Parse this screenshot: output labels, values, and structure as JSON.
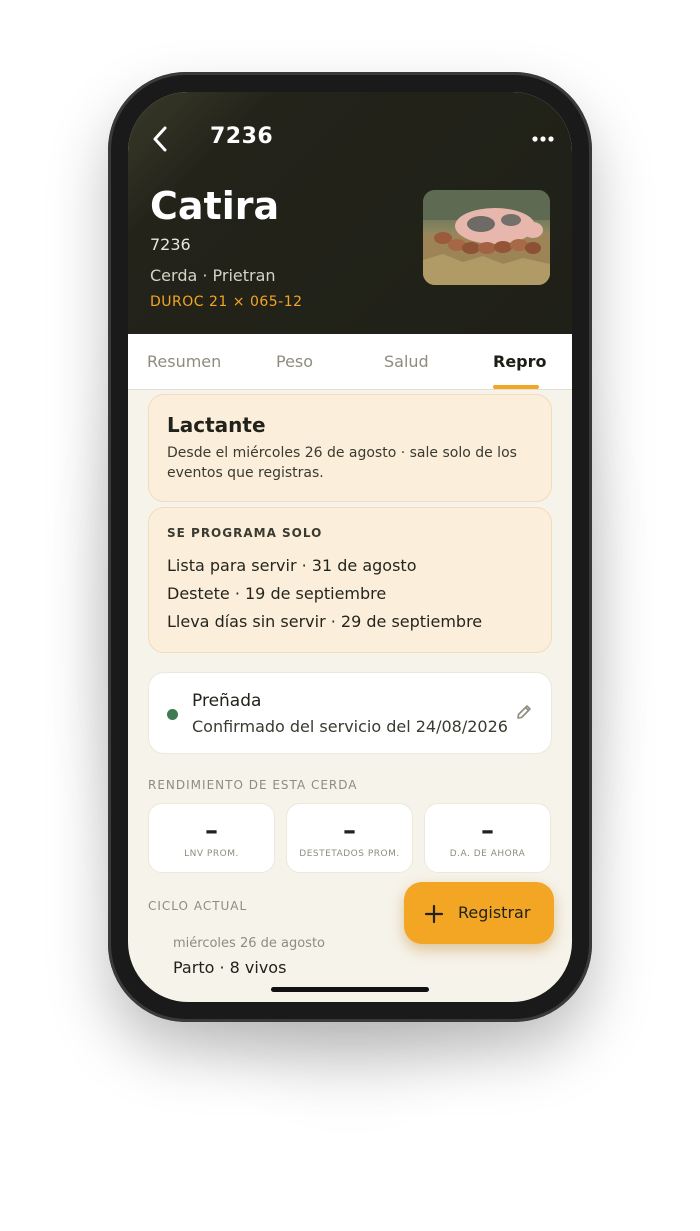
{
  "nav": {
    "title": "7236",
    "back_icon": "chevron-left-icon",
    "more_icon": "more-horizontal-icon"
  },
  "animal": {
    "name": "Catira",
    "tag": "7236",
    "breed": "Cerda · Prietran",
    "lineage": "DUROC 21 × 065-12",
    "photo": "sow-nursing-piglets-photo"
  },
  "tabs": [
    {
      "label": "Resumen"
    },
    {
      "label": "Peso"
    },
    {
      "label": "Salud"
    },
    {
      "label": "Repro",
      "active": true
    }
  ],
  "status_card": {
    "title": "Lactante",
    "description": "Desde el miércoles 26 de agosto · sale solo de los eventos que registras."
  },
  "schedule": {
    "title": "SE PROGRAMA SOLO",
    "items": [
      "Lista para servir · 31 de agosto",
      "Destete · 19 de septiembre",
      "Lleva días sin servir · 29 de septiembre"
    ]
  },
  "pregnancy": {
    "title": "Preñada",
    "subtitle": "Confirmado del servicio del 24/08/2026",
    "status_color": "#3f7a52",
    "edit_icon": "pencil-icon"
  },
  "performance": {
    "label": "RENDIMIENTO DE ESTA CERDA",
    "stats": [
      {
        "value": "–",
        "label": "LNV PROM."
      },
      {
        "value": "–",
        "label": "DESTETADOS PROM."
      },
      {
        "value": "–",
        "label": "D.A. DE AHORA"
      }
    ]
  },
  "cycle": {
    "label": "CICLO ACTUAL",
    "event_date": "miércoles 26 de agosto",
    "event_title": "Parto · 8 vivos"
  },
  "fab": {
    "label": "Registrar",
    "icon": "plus-icon"
  },
  "colors": {
    "accent": "#f3a524",
    "header": "#1f2017",
    "background": "#f6f3ea",
    "card_peach": "#fbeedb"
  }
}
